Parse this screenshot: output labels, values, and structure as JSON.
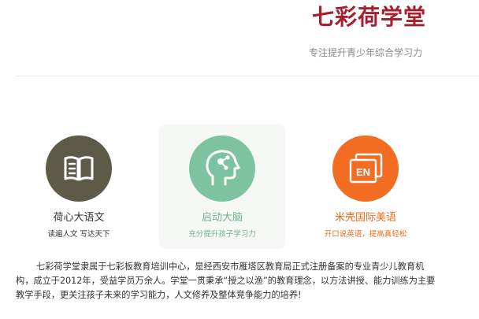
{
  "header": {
    "brand": "七彩荷学堂",
    "slogan": "专注提升青少年综合学习力"
  },
  "features": [
    {
      "icon": "book-icon",
      "title": "荷心大语文",
      "subtitle": "读遍人文 写达天下"
    },
    {
      "icon": "brain-icon",
      "title": "启动大脑",
      "subtitle": "充分提升孩子学习力"
    },
    {
      "icon": "english-icon",
      "icon_text": "EN",
      "title": "米壳国际美语",
      "subtitle": "开口说英语，提高真轻松"
    }
  ],
  "intro": "七彩荷学堂隶属于七彩板教育培训中心，是经西安市雁塔区教育局正式注册备案的专业青少儿教育机构，成立于2012年，受益学员万余人。学堂一贯秉承“授之以渔”的教育理念，以方法讲授、能力训练为主要教学手段，更关注孩子未来的学习能力，人文修养及整体竞争能力的培养!",
  "colors": {
    "brand": "#a81d2f",
    "slogan": "#8a8a8a",
    "book_circle": "#5d5a47",
    "brain_circle": "#7dc3a1",
    "english_circle": "#f26d21",
    "text_dark": "#333333",
    "accent_green": "#6bb48f",
    "accent_orange": "#e96a1c"
  }
}
